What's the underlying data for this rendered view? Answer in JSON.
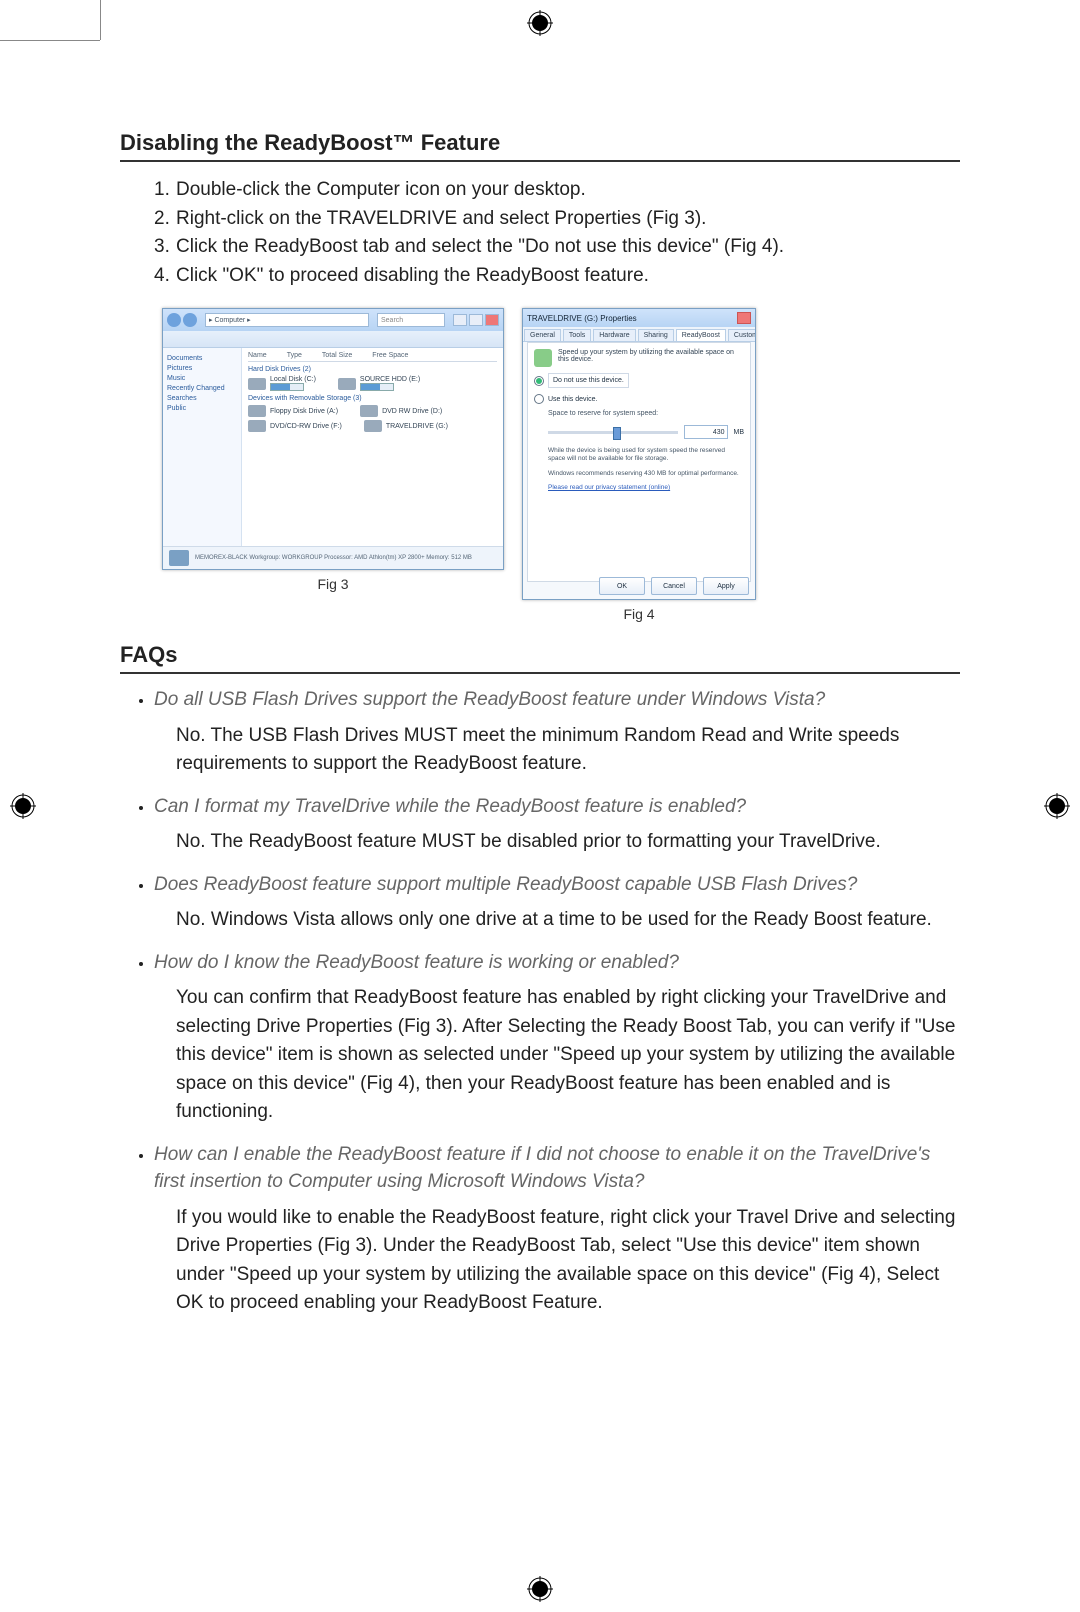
{
  "section1": {
    "heading": "Disabling the ReadyBoost™ Feature",
    "steps": [
      "Double-click the Computer icon on your desktop.",
      "Right-click on the TRAVELDRIVE and select Properties (Fig 3).",
      "Click the ReadyBoost tab and select the \"Do not use this device\" (Fig 4).",
      "Click \"OK\" to proceed disabling the ReadyBoost feature."
    ]
  },
  "fig3": {
    "caption": "Fig  3",
    "address": "▸  Computer  ▸",
    "search": "Search",
    "sidebar": [
      "Documents",
      "Pictures",
      "Music",
      "Recently Changed",
      "Searches",
      "Public"
    ],
    "columns": [
      "Name",
      "Type",
      "Total Size",
      "Free Space"
    ],
    "group1": "Hard Disk Drives (2)",
    "drives1": [
      {
        "label": "Local Disk (C:)"
      },
      {
        "label": "SOURCE HDD (E:)"
      }
    ],
    "group2": "Devices with Removable Storage (3)",
    "drives2": [
      {
        "label": "Floppy Disk Drive (A:)"
      },
      {
        "label": "DVD RW Drive (D:)"
      },
      {
        "label": "DVD/CD-RW Drive (F:)"
      },
      {
        "label": "TRAVELDRIVE (G:)"
      }
    ],
    "footer": "MEMOREX-BLACK   Workgroup: WORKGROUP   Processor: AMD Athlon(tm) XP 2800+   Memory: 512 MB"
  },
  "fig4": {
    "caption": "Fig  4",
    "title": "TRAVELDRIVE (G:) Properties",
    "tabs": [
      "General",
      "Tools",
      "Hardware",
      "Sharing",
      "ReadyBoost",
      "Customize"
    ],
    "hint": "Speed up your system by utilizing the available space on this device.",
    "radio1": "Do not use this device.",
    "radio2": "Use this device.",
    "reserveLabel": "Space to reserve for system speed:",
    "reserveValue": "430",
    "reserveUnit": "MB",
    "note1": "While the device is being used for system speed the reserved space will not be available for file storage.",
    "note2": "Windows recommends reserving 430 MB for optimal performance.",
    "privacy": "Please read our privacy statement (online)",
    "buttons": {
      "ok": "OK",
      "cancel": "Cancel",
      "apply": "Apply"
    }
  },
  "faqs": {
    "heading": "FAQs",
    "items": [
      {
        "q": "Do all USB Flash Drives support the ReadyBoost feature under Windows Vista?",
        "a": "No. The USB Flash Drives MUST meet the minimum Random Read and Write speeds requirements to support the ReadyBoost feature."
      },
      {
        "q": "Can I format my TravelDrive while the ReadyBoost feature is enabled?",
        "a": "No. The ReadyBoost feature MUST be disabled prior to formatting your TravelDrive."
      },
      {
        "q": "Does ReadyBoost feature support multiple ReadyBoost capable USB Flash Drives?",
        "a": "No. Windows Vista allows only one drive at a time to be used for the Ready Boost feature."
      },
      {
        "q": "How do I know the ReadyBoost feature is working or enabled?",
        "a": "You can confirm that ReadyBoost feature has enabled by right clicking your TravelDrive and selecting Drive Properties (Fig 3). After Selecting the Ready Boost Tab, you can verify if \"Use this device\" item is shown as selected under \"Speed up your system by utilizing the available space on this device\" (Fig 4), then your ReadyBoost feature has been enabled and is functioning."
      },
      {
        "q": "How can I enable the ReadyBoost feature if I did not choose to enable it on the TravelDrive's first insertion to Computer using Microsoft Windows Vista?",
        "a": "If you would like to enable the ReadyBoost feature, right click  your Travel Drive and selecting Drive Properties (Fig 3).  Under the ReadyBoost Tab, select \"Use this device\" item shown under \"Speed up your system by utilizing the available space on this device\" (Fig 4), Select OK to proceed enabling your ReadyBoost Feature."
      }
    ]
  }
}
